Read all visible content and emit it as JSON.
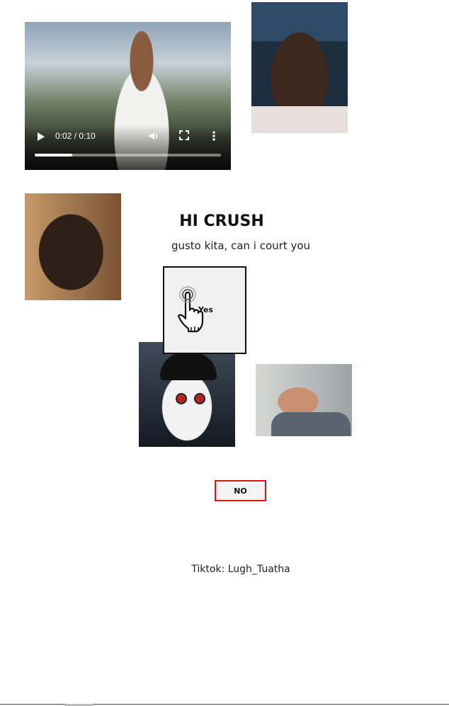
{
  "video": {
    "time": "0:02 / 0:10",
    "progress": 0.2,
    "controls": {
      "play_icon": "play-icon",
      "volume_icon": "volume-icon",
      "fullscreen_icon": "fullscreen-icon",
      "more_icon": "more-vertical-icon"
    }
  },
  "heading": {
    "title": "HI CRUSH",
    "subtitle": "gusto kita, can i court you"
  },
  "buttons": {
    "yes_label": "Yes",
    "no_label": "NO"
  },
  "footer": {
    "tiktok": "Tiktok: Lugh_Tuatha"
  },
  "colors": {
    "no_border": "#dd1111",
    "yes_background": "#f0f0f0"
  }
}
